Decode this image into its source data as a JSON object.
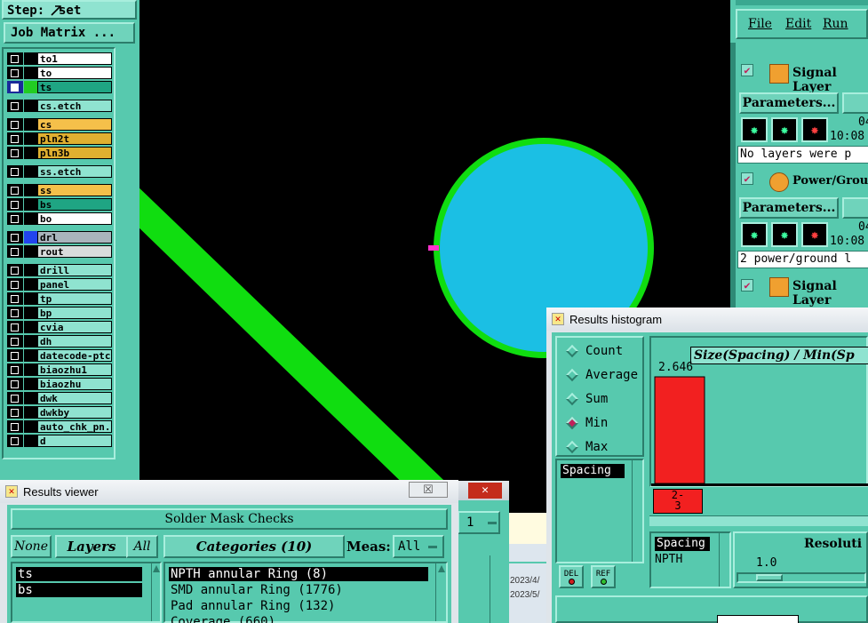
{
  "left_panel": {
    "step_label": "Step:",
    "step_value": "set",
    "job_matrix_label": "Job Matrix ...",
    "layers": [
      {
        "name": "to1",
        "color": "#ffffff",
        "indicator": ""
      },
      {
        "name": "to",
        "color": "#ffffff",
        "indicator": ""
      },
      {
        "name": "ts",
        "color": "#1fa583",
        "indicator": "#22cc22",
        "active": true
      },
      {
        "name": "cs.etch",
        "color": "#8fe3d0",
        "indicator": ""
      },
      {
        "name": "cs",
        "color": "#f5c04a",
        "indicator": ""
      },
      {
        "name": "pln2t",
        "color": "#e0b030",
        "indicator": ""
      },
      {
        "name": "pln3b",
        "color": "#e0b030",
        "indicator": ""
      },
      {
        "name": "ss.etch",
        "color": "#8fe3d0",
        "indicator": ""
      },
      {
        "name": "ss",
        "color": "#f5c04a",
        "indicator": ""
      },
      {
        "name": "bs",
        "color": "#1fa583",
        "indicator": ""
      },
      {
        "name": "bo",
        "color": "#ffffff",
        "indicator": ""
      },
      {
        "name": "drl",
        "color": "#a9b4bc",
        "indicator": "#2244ee"
      },
      {
        "name": "rout",
        "color": "#d8dcdc",
        "indicator": ""
      },
      {
        "name": "drill",
        "color": "#8fe3d0",
        "indicator": ""
      },
      {
        "name": "panel",
        "color": "#8fe3d0",
        "indicator": ""
      },
      {
        "name": "tp",
        "color": "#8fe3d0",
        "indicator": ""
      },
      {
        "name": "bp",
        "color": "#8fe3d0",
        "indicator": ""
      },
      {
        "name": "cvia",
        "color": "#8fe3d0",
        "indicator": ""
      },
      {
        "name": "dh",
        "color": "#8fe3d0",
        "indicator": ""
      },
      {
        "name": "datecode-ptc",
        "color": "#8fe3d0",
        "indicator": ""
      },
      {
        "name": "biaozhu1",
        "color": "#8fe3d0",
        "indicator": ""
      },
      {
        "name": "biaozhu",
        "color": "#8fe3d0",
        "indicator": ""
      },
      {
        "name": "dwk",
        "color": "#8fe3d0",
        "indicator": ""
      },
      {
        "name": "dwkby",
        "color": "#8fe3d0",
        "indicator": ""
      },
      {
        "name": "auto_chk_pn.",
        "color": "#8fe3d0",
        "indicator": ""
      },
      {
        "name": "d",
        "color": "#8fe3d0",
        "indicator": ""
      }
    ]
  },
  "right_panel": {
    "menu": [
      "File",
      "Edit",
      "Run"
    ],
    "sections": [
      {
        "title": "Signal Layer",
        "parameters_label": "Parameters...",
        "time_partial": "04",
        "time": "10:08",
        "message": "No layers were p"
      },
      {
        "title": "Power/Ground",
        "parameters_label": "Parameters...",
        "time_partial": "04",
        "time": "10:08",
        "message": "2 power/ground l"
      },
      {
        "title": "Signal Layer"
      }
    ]
  },
  "results_viewer": {
    "title": "Results viewer",
    "close_glyph": "☒",
    "section_title": "Solder Mask Checks",
    "none_label": "None",
    "layers_label": "Layers",
    "all_label": "All",
    "categories_label": "Categories (10)",
    "meas_label": "Meas:",
    "meas_value": "All",
    "layers": [
      "ts",
      "bs"
    ],
    "categories": [
      "NPTH annular Ring (8)",
      "SMD annular Ring (1776)",
      "Pad annular Ring (132)",
      "Coverage (660)"
    ]
  },
  "background_window": {
    "close_glyph": "✕",
    "partial_field": "1",
    "dates": [
      "2023/4/",
      "2023/5/"
    ]
  },
  "histogram": {
    "title": "Results histogram",
    "modes": [
      {
        "label": "Count",
        "selected": false
      },
      {
        "label": "Average",
        "selected": false
      },
      {
        "label": "Sum",
        "selected": false
      },
      {
        "label": "Min",
        "selected": true
      },
      {
        "label": "Max",
        "selected": false
      }
    ],
    "left_list": [
      "Spacing"
    ],
    "chart_title": "Size(Spacing) / Min(Sp",
    "bar_value_label": "2.646",
    "bin_label": "2-\n3",
    "bottom_list": [
      "Spacing",
      "NPTH"
    ],
    "del_label": "DEL",
    "ref_label": "REF",
    "resolution_label": "Resoluti",
    "resolution_value": "1.0"
  },
  "chart_data": {
    "type": "bar",
    "title": "Size(Spacing) / Min(Sp",
    "categories": [
      "2-3"
    ],
    "values": [
      2.646
    ],
    "xlabel": "",
    "ylabel": ""
  }
}
